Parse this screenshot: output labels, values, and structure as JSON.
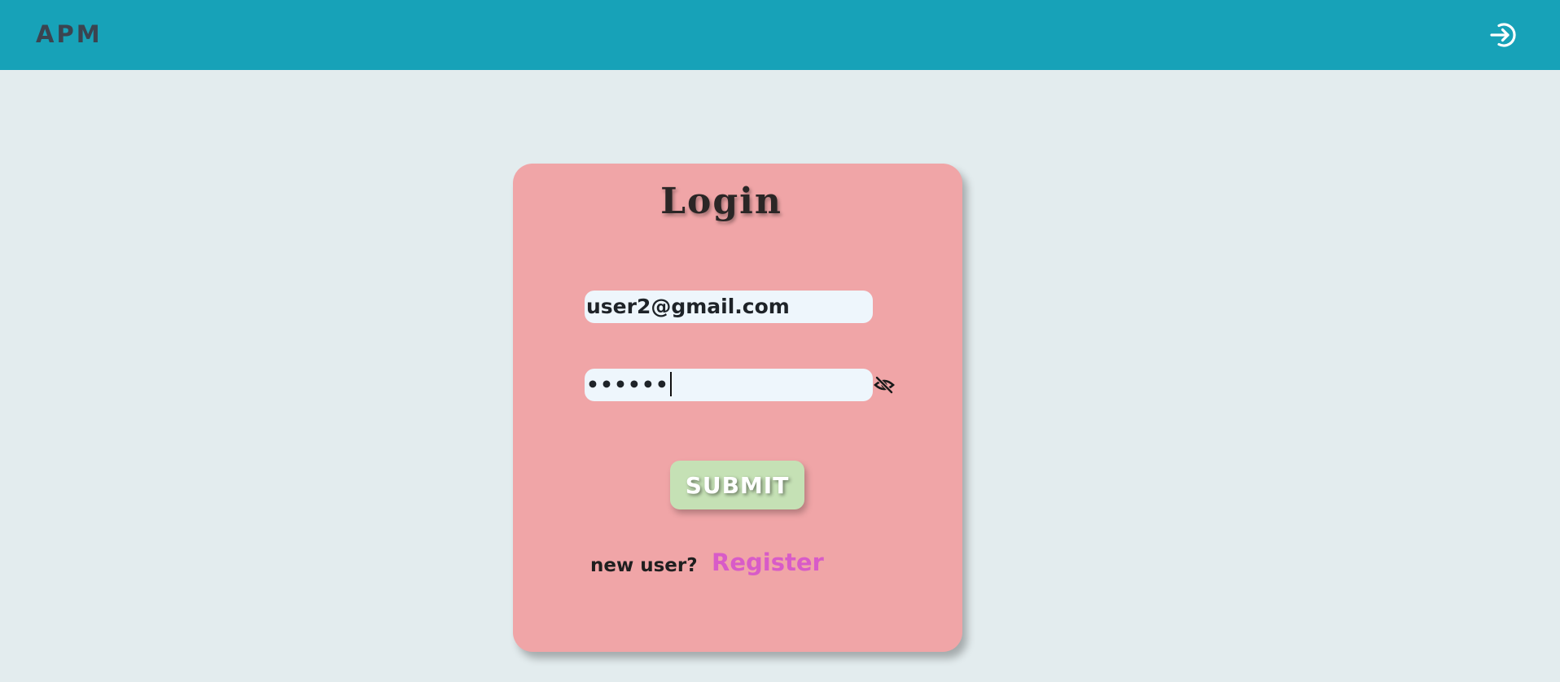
{
  "header": {
    "brand": "APM",
    "login_icon": "login-icon",
    "background_color": "#17a2b8"
  },
  "login_card": {
    "title": "Login",
    "background_color": "#f0a5a7",
    "email_field": {
      "value": "user2@gmail.com",
      "type": "email"
    },
    "password_field": {
      "value": "••••••",
      "type": "password",
      "toggle_icon": "eye-slash-icon"
    },
    "submit_label": "SUBMIT",
    "submit_color": "#c5e1b5",
    "new_user_text": "new user?",
    "register_link": "Register",
    "register_color": "#d85bc8"
  },
  "page_background": "#e3ecee"
}
